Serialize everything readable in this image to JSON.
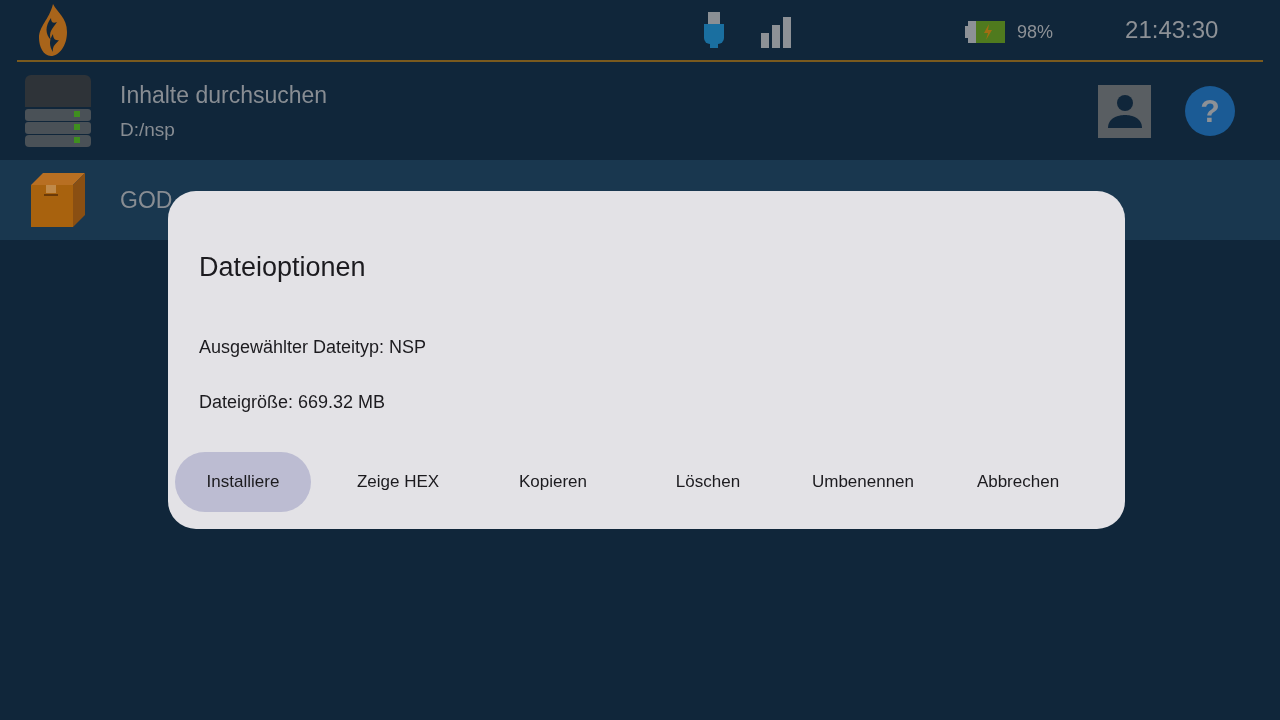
{
  "status_bar": {
    "battery": "98%",
    "time": "21:43:30"
  },
  "list": [
    {
      "kind": "drive",
      "title": "Inhalte durchsuchen",
      "subtitle": "D:/nsp",
      "selected": false
    },
    {
      "kind": "package",
      "title": "GOD",
      "selected": true
    }
  ],
  "help_button": "?",
  "dialog": {
    "title": "Dateioptionen",
    "lines": [
      "Ausgewählter Dateityp: NSP",
      "Dateigröße: 669.32 MB"
    ],
    "buttons": [
      {
        "label": "Installiere",
        "selected": true
      },
      {
        "label": "Zeige HEX",
        "selected": false
      },
      {
        "label": "Kopieren",
        "selected": false
      },
      {
        "label": "Löschen",
        "selected": false
      },
      {
        "label": "Umbenennen",
        "selected": false
      },
      {
        "label": "Abbrechen",
        "selected": false
      }
    ]
  }
}
